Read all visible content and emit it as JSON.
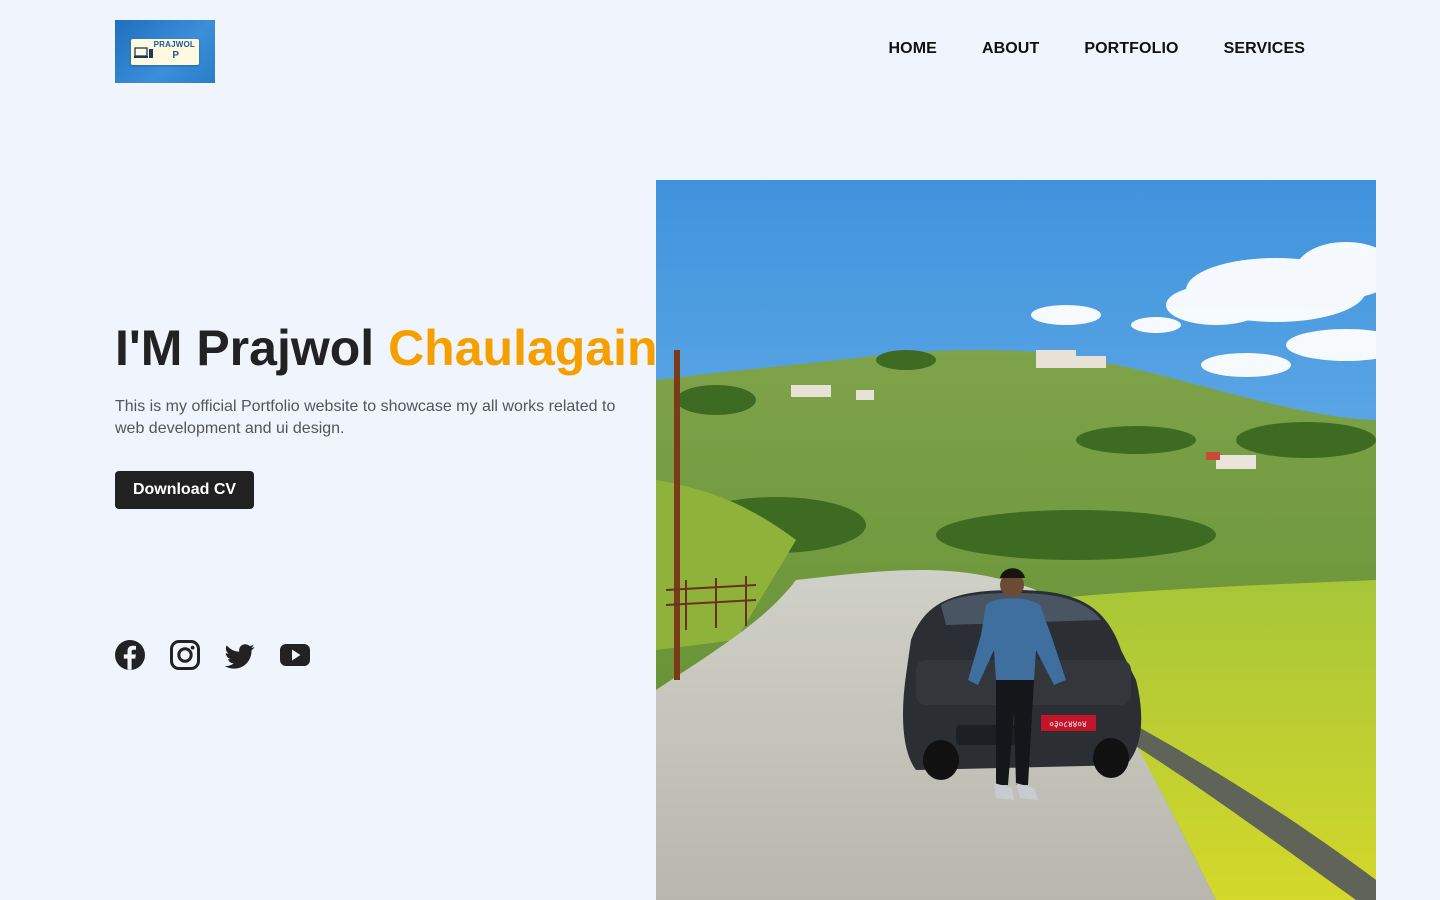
{
  "header": {
    "logo": {
      "text": "PRAJWOL",
      "mark": "P",
      "icon": "laptop-icon"
    },
    "nav": [
      {
        "label": "HOME"
      },
      {
        "label": "ABOUT"
      },
      {
        "label": "PORTFOLIO"
      },
      {
        "label": "SERVICES"
      }
    ]
  },
  "hero": {
    "title_prefix": "I'M Prajwol",
    "title_accent": "Chaulagain",
    "description": "This is my official Portfolio website to showcase my all works related to web development and ui design.",
    "cv_button": "Download CV",
    "socials": [
      {
        "icon": "facebook-icon"
      },
      {
        "icon": "instagram-icon"
      },
      {
        "icon": "twitter-icon"
      },
      {
        "icon": "youtube-icon"
      }
    ],
    "photo": {
      "subject": "person-with-car-photo",
      "plate_text": "०३०८४४०४"
    }
  },
  "colors": {
    "background": "#eff4fd",
    "accent": "#f5a000",
    "button": "#212121",
    "text": "#222222"
  }
}
